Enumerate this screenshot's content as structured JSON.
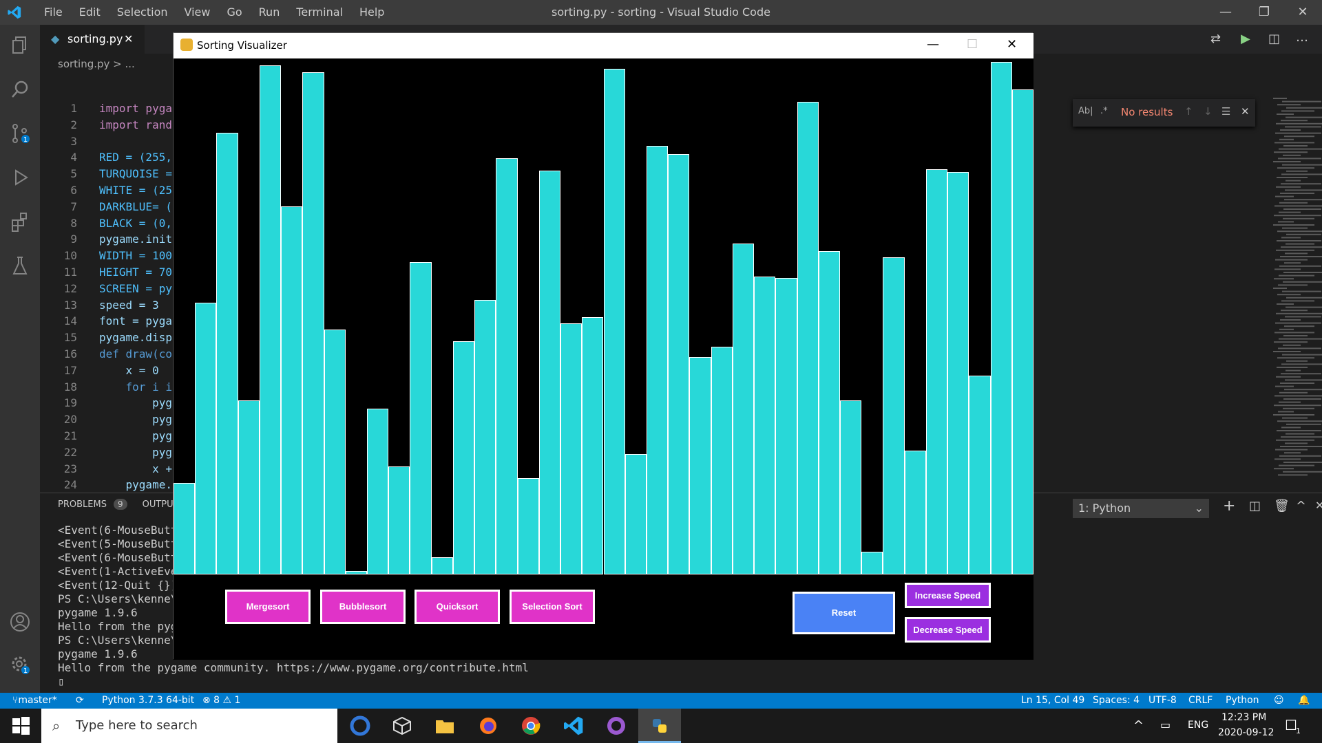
{
  "vscode": {
    "window_title": "sorting.py - sorting - Visual Studio Code",
    "menu": [
      "File",
      "Edit",
      "Selection",
      "View",
      "Go",
      "Run",
      "Terminal",
      "Help"
    ],
    "tab_label": "sorting.py",
    "breadcrumb": "sorting.py > ...",
    "code_lines": [
      {
        "n": "1",
        "t": "import pyga"
      },
      {
        "n": "2",
        "t": "import rand"
      },
      {
        "n": "3",
        "t": ""
      },
      {
        "n": "4",
        "t": "RED = (255,"
      },
      {
        "n": "5",
        "t": "TURQUOISE ="
      },
      {
        "n": "6",
        "t": "WHITE = (25"
      },
      {
        "n": "7",
        "t": "DARKBLUE= ("
      },
      {
        "n": "8",
        "t": "BLACK = (0,"
      },
      {
        "n": "9",
        "t": "pygame.init"
      },
      {
        "n": "10",
        "t": "WIDTH = 100"
      },
      {
        "n": "11",
        "t": "HEIGHT = 70"
      },
      {
        "n": "12",
        "t": "SCREEN = py"
      },
      {
        "n": "13",
        "t": "speed = 3"
      },
      {
        "n": "14",
        "t": "font = pyga"
      },
      {
        "n": "15",
        "t": "pygame.disp"
      },
      {
        "n": "16",
        "t": "def draw(co"
      },
      {
        "n": "17",
        "t": "    x = 0"
      },
      {
        "n": "18",
        "t": "    for i i"
      },
      {
        "n": "19",
        "t": "        pyg"
      },
      {
        "n": "20",
        "t": "        pyg"
      },
      {
        "n": "21",
        "t": "        pyg"
      },
      {
        "n": "22",
        "t": "        pyg"
      },
      {
        "n": "23",
        "t": "        x +"
      },
      {
        "n": "24",
        "t": "    pygame."
      }
    ],
    "panel": {
      "problems_label": "PROBLEMS",
      "problems_count": "9",
      "output_label": "OUTPU",
      "terminal_select": "1: Python",
      "terminal_lines": [
        "<Event(6-MouseButto",
        "<Event(5-MouseButto",
        "<Event(6-MouseButto",
        "<Event(1-ActiveEven",
        "<Event(12-Quit {}):",
        "PS C:\\Users\\kenne\\D",
        "pygame 1.9.6",
        "Hello from the pyga",
        "PS C:\\Users\\kenne\\D",
        "pygame 1.9.6",
        "Hello from the pygame community. https://www.pygame.org/contribute.html",
        "▯"
      ]
    },
    "find": {
      "no_results": "No results"
    },
    "status": {
      "branch": "master*",
      "python": "Python 3.7.3 64-bit",
      "errors": "⊗ 8 ⚠ 1",
      "position": "Ln 15, Col 49",
      "spaces": "Spaces: 4",
      "encoding": "UTF-8",
      "eol": "CRLF",
      "language": "Python"
    }
  },
  "pygame_window": {
    "title": "Sorting Visualizer",
    "bar_color": "#28d8d8",
    "bar_values": [
      133,
      395,
      642,
      253,
      740,
      535,
      730,
      356,
      5,
      241,
      157,
      454,
      25,
      339,
      399,
      605,
      140,
      587,
      365,
      374,
      735,
      175,
      623,
      611,
      316,
      331,
      481,
      433,
      431,
      687,
      470,
      253,
      33,
      461,
      180,
      589,
      585,
      289,
      745,
      705
    ],
    "buttons": {
      "mergesort": "Mergesort",
      "bubblesort": "Bubblesort",
      "quicksort": "Quicksort",
      "selection_sort": "Selection Sort",
      "reset": "Reset",
      "increase_speed": "Increase Speed",
      "decrease_speed": "Decrease Speed"
    },
    "colors": {
      "sort_button": "#e033c8",
      "reset_button": "#4a82f5",
      "speed_button": "#9b2fe0"
    }
  },
  "taskbar": {
    "search_placeholder": "Type here to search",
    "language": "ENG",
    "time": "12:23 PM",
    "date": "2020-09-12",
    "notifications": "1"
  }
}
